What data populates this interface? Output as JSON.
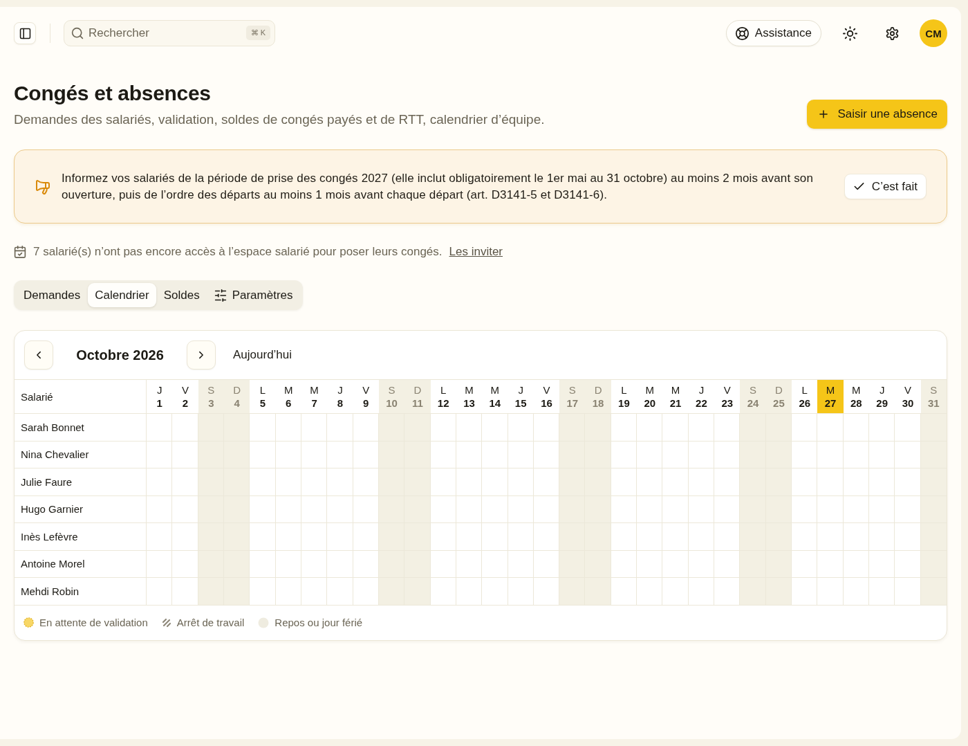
{
  "topbar": {
    "search": {
      "placeholder": "Rechercher",
      "shortcut": "⌘ K"
    },
    "assistance": "Assistance",
    "avatar": "CM"
  },
  "header": {
    "title": "Congés et absences",
    "subtitle": "Demandes des salariés, validation, soldes de congés payés et de RTT, calendrier d’équipe.",
    "action": "Saisir une absence"
  },
  "notice": {
    "text": "Informez vos salariés de la période de prise des congés 2027 (elle inclut obligatoirement le 1er mai au 31 octobre) au moins 2 mois avant son ouverture, puis de l’ordre des départs au moins 1 mois avant chaque départ (art. D3141-5 et D3141-6).",
    "action": "C’est fait"
  },
  "invite": {
    "text": "7 salarié(s) n’ont pas encore accès à l’espace salarié pour poser leurs congés.",
    "link": "Les inviter"
  },
  "tabs": [
    {
      "label": "Demandes",
      "selected": false,
      "kind": "plain"
    },
    {
      "label": "Calendrier",
      "selected": true,
      "kind": "plain"
    },
    {
      "label": "Soldes",
      "selected": false,
      "kind": "plain"
    },
    {
      "label": "Paramètres",
      "selected": false,
      "kind": "with-icon"
    }
  ],
  "calendar": {
    "month": "Octobre 2026",
    "today_button": "Aujourd’hui",
    "name_header": "Salarié",
    "days": [
      {
        "weekday": "J",
        "date": "1",
        "weekend": false,
        "today": false
      },
      {
        "weekday": "V",
        "date": "2",
        "weekend": false,
        "today": false
      },
      {
        "weekday": "S",
        "date": "3",
        "weekend": true,
        "today": false
      },
      {
        "weekday": "D",
        "date": "4",
        "weekend": true,
        "today": false
      },
      {
        "weekday": "L",
        "date": "5",
        "weekend": false,
        "today": false
      },
      {
        "weekday": "M",
        "date": "6",
        "weekend": false,
        "today": false
      },
      {
        "weekday": "M",
        "date": "7",
        "weekend": false,
        "today": false
      },
      {
        "weekday": "J",
        "date": "8",
        "weekend": false,
        "today": false
      },
      {
        "weekday": "V",
        "date": "9",
        "weekend": false,
        "today": false
      },
      {
        "weekday": "S",
        "date": "10",
        "weekend": true,
        "today": false
      },
      {
        "weekday": "D",
        "date": "11",
        "weekend": true,
        "today": false
      },
      {
        "weekday": "L",
        "date": "12",
        "weekend": false,
        "today": false
      },
      {
        "weekday": "M",
        "date": "13",
        "weekend": false,
        "today": false
      },
      {
        "weekday": "M",
        "date": "14",
        "weekend": false,
        "today": false
      },
      {
        "weekday": "J",
        "date": "15",
        "weekend": false,
        "today": false
      },
      {
        "weekday": "V",
        "date": "16",
        "weekend": false,
        "today": false
      },
      {
        "weekday": "S",
        "date": "17",
        "weekend": true,
        "today": false
      },
      {
        "weekday": "D",
        "date": "18",
        "weekend": true,
        "today": false
      },
      {
        "weekday": "L",
        "date": "19",
        "weekend": false,
        "today": false
      },
      {
        "weekday": "M",
        "date": "20",
        "weekend": false,
        "today": false
      },
      {
        "weekday": "M",
        "date": "21",
        "weekend": false,
        "today": false
      },
      {
        "weekday": "J",
        "date": "22",
        "weekend": false,
        "today": false
      },
      {
        "weekday": "V",
        "date": "23",
        "weekend": false,
        "today": false
      },
      {
        "weekday": "S",
        "date": "24",
        "weekend": true,
        "today": false
      },
      {
        "weekday": "D",
        "date": "25",
        "weekend": true,
        "today": false
      },
      {
        "weekday": "L",
        "date": "26",
        "weekend": false,
        "today": false
      },
      {
        "weekday": "M",
        "date": "27",
        "weekend": false,
        "today": true
      },
      {
        "weekday": "M",
        "date": "28",
        "weekend": false,
        "today": false
      },
      {
        "weekday": "J",
        "date": "29",
        "weekend": false,
        "today": false
      },
      {
        "weekday": "V",
        "date": "30",
        "weekend": false,
        "today": false
      },
      {
        "weekday": "S",
        "date": "31",
        "weekend": true,
        "today": false
      }
    ],
    "employees": [
      "Sarah Bonnet",
      "Nina Chevalier",
      "Julie Faure",
      "Hugo Garnier",
      "Inès Lefèvre",
      "Antoine Morel",
      "Mehdi Robin"
    ],
    "legend": [
      {
        "label": "En attente de validation",
        "kind": "pending"
      },
      {
        "label": "Arrêt de travail",
        "kind": "sick"
      },
      {
        "label": "Repos ou jour férié",
        "kind": "rest"
      }
    ]
  }
}
